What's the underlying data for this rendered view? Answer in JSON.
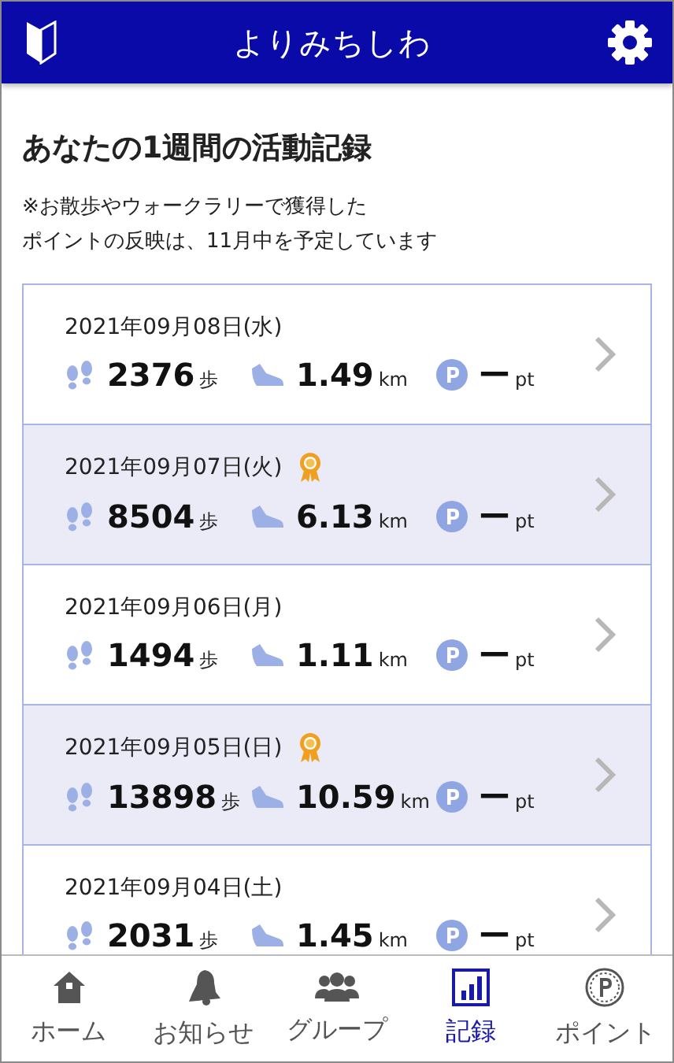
{
  "header": {
    "title": "よりみちしわ"
  },
  "heading": "あなたの1週間の活動記録",
  "note": [
    "※お散歩やウォークラリーで獲得した",
    "ポイントの反映は、11月中を予定しています"
  ],
  "records": [
    {
      "date": "2021年09月08日(水)",
      "awarded": false,
      "steps": "2376",
      "steps_unit": "歩",
      "distance": "1.49",
      "distance_unit": "km",
      "points": "ー",
      "points_unit": "pt"
    },
    {
      "date": "2021年09月07日(火)",
      "awarded": true,
      "steps": "8504",
      "steps_unit": "歩",
      "distance": "6.13",
      "distance_unit": "km",
      "points": "ー",
      "points_unit": "pt"
    },
    {
      "date": "2021年09月06日(月)",
      "awarded": false,
      "steps": "1494",
      "steps_unit": "歩",
      "distance": "1.11",
      "distance_unit": "km",
      "points": "ー",
      "points_unit": "pt"
    },
    {
      "date": "2021年09月05日(日)",
      "awarded": true,
      "steps": "13898",
      "steps_unit": "歩",
      "distance": "10.59",
      "distance_unit": "km",
      "points": "ー",
      "points_unit": "pt"
    },
    {
      "date": "2021年09月04日(土)",
      "awarded": false,
      "steps": "2031",
      "steps_unit": "歩",
      "distance": "1.45",
      "distance_unit": "km",
      "points": "ー",
      "points_unit": "pt"
    }
  ],
  "tabs": [
    {
      "kind": "home",
      "label": "ホーム",
      "selected": false
    },
    {
      "kind": "bell",
      "label": "お知らせ",
      "selected": false
    },
    {
      "kind": "group",
      "label": "グループ",
      "selected": false
    },
    {
      "kind": "chart",
      "label": "記録",
      "selected": true
    },
    {
      "kind": "point",
      "label": "ポイント",
      "selected": false
    }
  ]
}
